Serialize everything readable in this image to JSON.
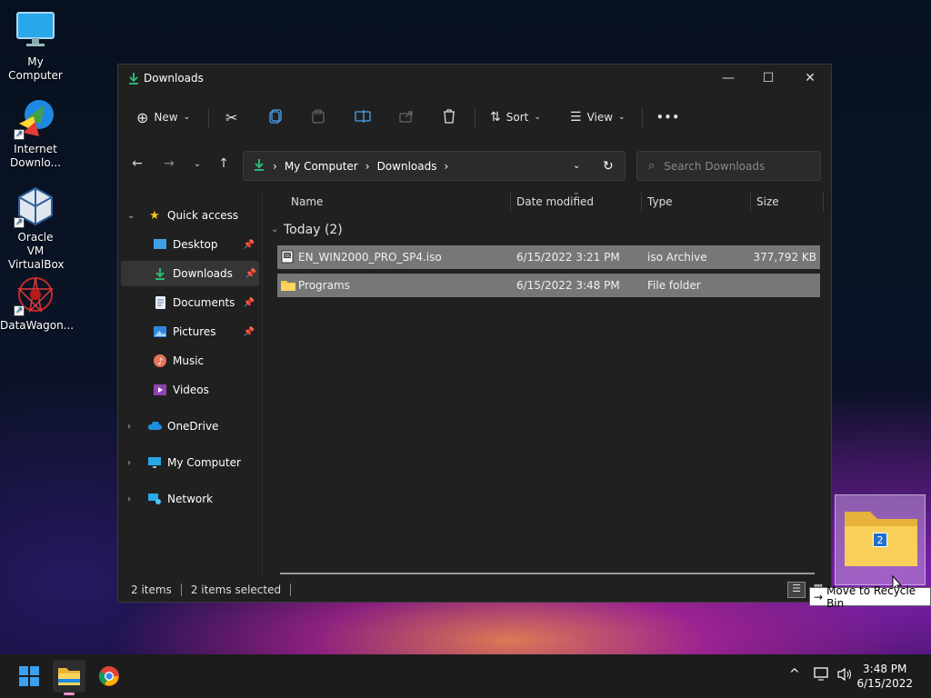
{
  "desktop": {
    "icons": [
      {
        "label": "My Computer",
        "icon": "monitor-icon"
      },
      {
        "label": "Internet Downlo...",
        "icon": "idm-icon"
      },
      {
        "label": "Oracle VM VirtualBox",
        "icon": "virtualbox-icon"
      },
      {
        "label": "DataWagon...",
        "icon": "datawagon-icon"
      }
    ]
  },
  "window": {
    "title": "Downloads",
    "controls": {
      "minimize": "—",
      "maximize": "☐",
      "close": "✕"
    },
    "toolbar": {
      "new_label": "New",
      "sort_label": "Sort",
      "view_label": "View",
      "more_label": "•••"
    },
    "address": {
      "crumbs": [
        "My Computer",
        "Downloads"
      ],
      "separator": "›"
    },
    "search": {
      "placeholder": "Search Downloads"
    },
    "nav": {
      "quick_access": "Quick access",
      "items": [
        {
          "label": "Desktop",
          "pinned": true
        },
        {
          "label": "Downloads",
          "pinned": true,
          "selected": true
        },
        {
          "label": "Documents",
          "pinned": true
        },
        {
          "label": "Pictures",
          "pinned": true
        },
        {
          "label": "Music",
          "pinned": false
        },
        {
          "label": "Videos",
          "pinned": false
        }
      ],
      "onedrive": "OneDrive",
      "my_computer": "My Computer",
      "network": "Network"
    },
    "columns": [
      "Name",
      "Date modified",
      "Type",
      "Size"
    ],
    "group_label": "Today (2)",
    "files": [
      {
        "name": "EN_WIN2000_PRO_SP4.iso",
        "date": "6/15/2022 3:21 PM",
        "type": "iso Archive",
        "size": "377,792 KB"
      },
      {
        "name": "Programs",
        "date": "6/15/2022 3:48 PM",
        "type": "File folder",
        "size": ""
      }
    ],
    "status": {
      "count": "2 items",
      "selected": "2 items selected"
    }
  },
  "drag": {
    "count": "2",
    "tooltip": "Move to Recycle Bin",
    "arrow": "→"
  },
  "taskbar": {
    "time": "3:48 PM",
    "date": "6/15/2022",
    "tray": {
      "chevron": "^"
    }
  },
  "colors": {
    "accent_green": "#2bb673",
    "selection": "#777777",
    "window_bg": "#202020",
    "taskbar_bg": "#1c1c1c"
  }
}
